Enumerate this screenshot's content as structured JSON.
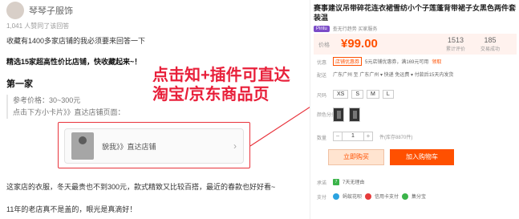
{
  "article": {
    "author_name": "琴琴子服饰",
    "follow_meta": "1,041 人赞同了该回答",
    "intro": "收藏有1400多家店铺的我必须要来回答一下",
    "bold_line": "精选15家超高性价比店铺，快收藏起来~！",
    "section_title": "第一家",
    "ref_price": "参考价格：30~300元",
    "click_hint": "点击下方小卡片》》直达店铺页面：",
    "store_card": {
      "label": "貌我》》直达店铺"
    },
    "bottom_line1": "这家店的衣服，冬天最贵也不到300元，款式精致又比较百搭，最近的春款也好好看~",
    "bottom_line2": "11年的老店真不是盖的，眼光是真滴好！"
  },
  "callout": {
    "line1": "点击知+插件可直达",
    "line2": "淘宝/京东商品页",
    "color": "#e8203a"
  },
  "product": {
    "title": "赛事建议吊带碎花连衣裙雪纺小个子莲蓬背带裙子女黑色两件套装温",
    "tag": "Pintu",
    "tag_meta": "查无行趋势  买家服务",
    "price_label": "价格",
    "price": "¥99.00",
    "stat_a_value": "1513",
    "stat_a_label": "累计评价",
    "stat_b_value": "185",
    "stat_b_label": "交易成功",
    "coupon_label": "优惠",
    "coupon_tag": "店铺优惠券",
    "coupon_text": "5元店铺优惠券，满169元可用",
    "coupon_get": "领取",
    "ship_label": "配送",
    "ship_text": "广东广州 至 广东广州 ▾  快递 免运费 ▾  付款后15天内发货",
    "size_label": "尺码",
    "sizes": [
      "XS",
      "S",
      "M",
      "L"
    ],
    "color_label": "颜色分类",
    "qty_label": "数量",
    "qty_value": "1",
    "qty_stock": "件(库存8870件)",
    "buy_now": "立即购买",
    "add_cart": "加入购物车",
    "commit_label": "承诺",
    "commit_text": "7天无理由",
    "pay_label": "支付",
    "pay_items": [
      "蚂蚁花呗",
      "信用卡支付",
      "集分宝"
    ],
    "price_color": "#ff5000"
  }
}
